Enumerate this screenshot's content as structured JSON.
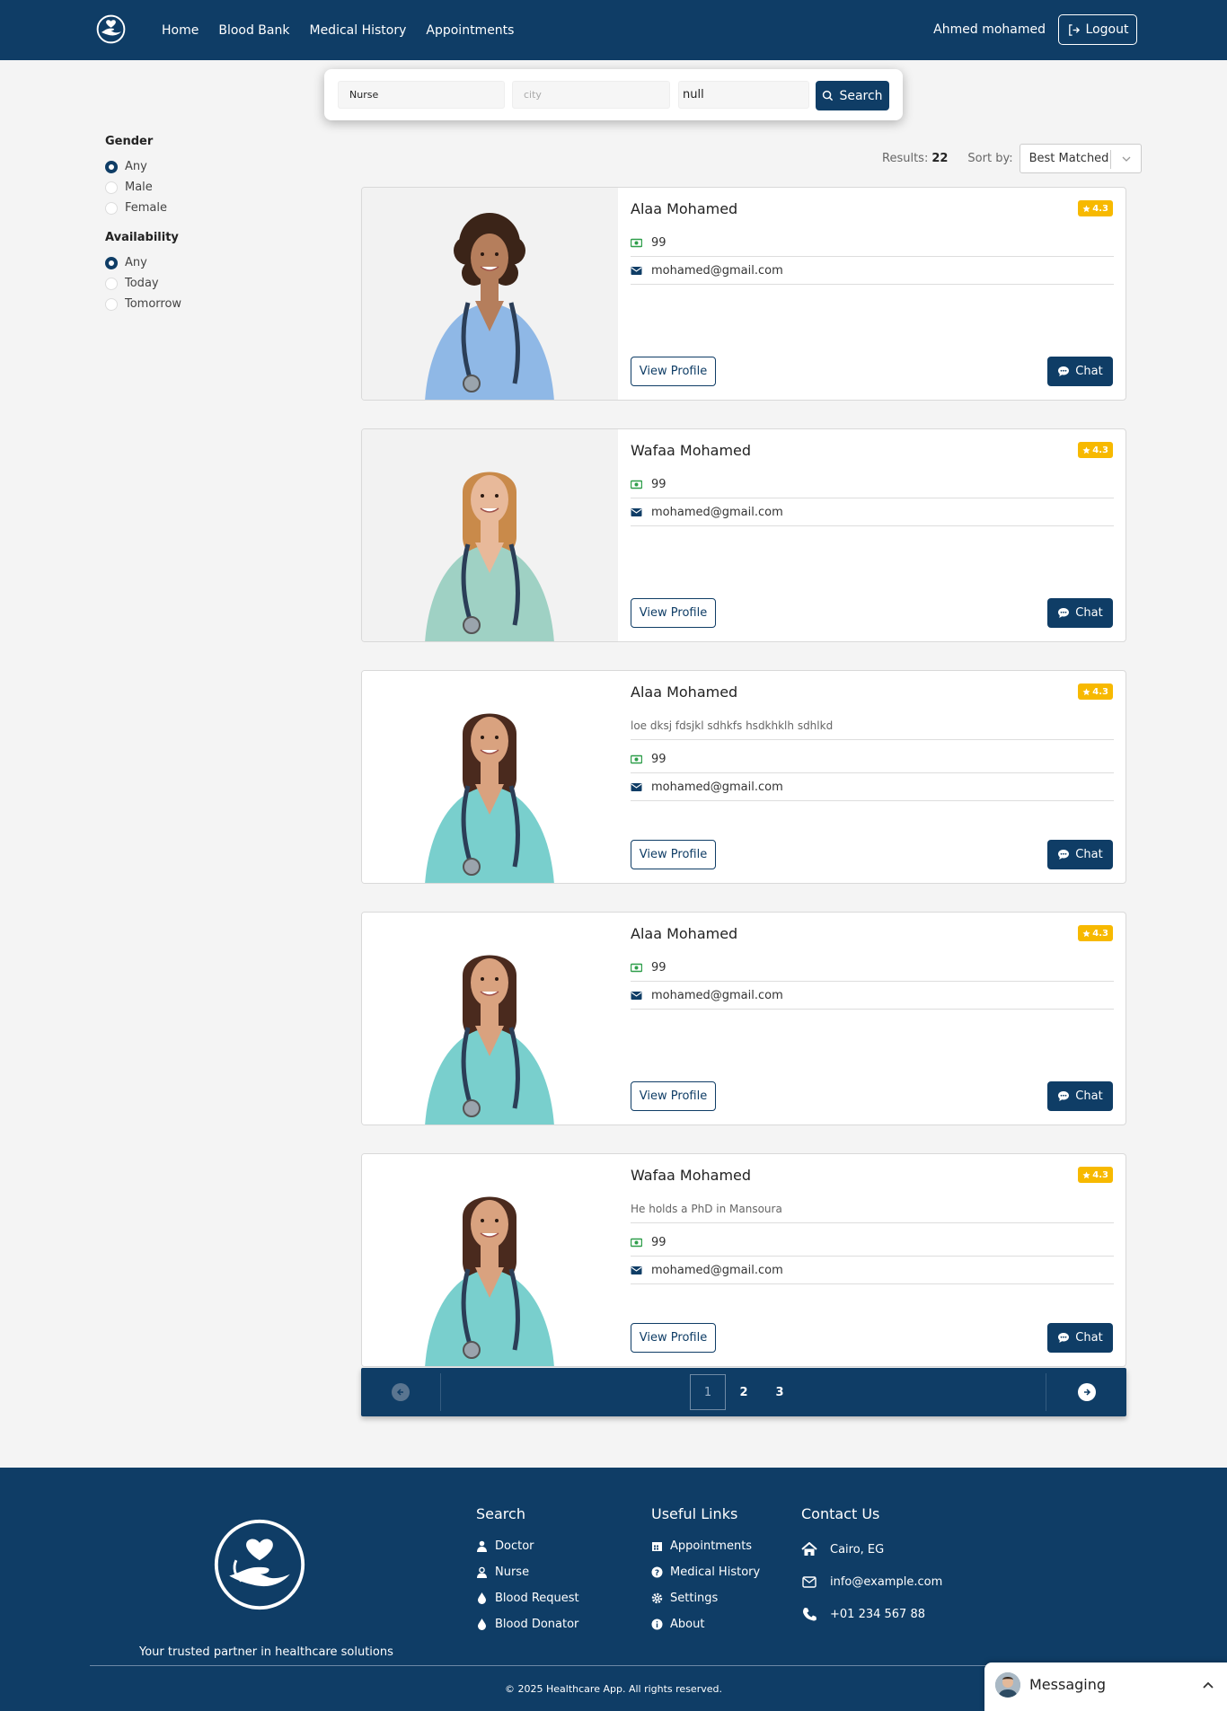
{
  "nav": {
    "links": [
      "Home",
      "Blood Bank",
      "Medical History",
      "Appointments"
    ],
    "user_name": "Ahmed mohamed",
    "logout_label": "Logout"
  },
  "search": {
    "specialty_value": "Nurse",
    "city_placeholder": "city",
    "third_value": "null",
    "button_label": "Search"
  },
  "filters": {
    "gender": {
      "title": "Gender",
      "options": [
        "Any",
        "Male",
        "Female"
      ],
      "selected": "Any"
    },
    "availability": {
      "title": "Availability",
      "options": [
        "Any",
        "Today",
        "Tomorrow"
      ],
      "selected": "Any"
    }
  },
  "results": {
    "label": "Results:",
    "count": "22",
    "sort_label": "Sort by:",
    "sort_value": "Best Matched"
  },
  "cards": [
    {
      "name": "Alaa Mohamed",
      "rating": "4.3",
      "description": "",
      "price": "99",
      "email": "mohamed@gmail.com",
      "view_label": "View Profile",
      "chat_label": "Chat"
    },
    {
      "name": "Wafaa Mohamed",
      "rating": "4.3",
      "description": "",
      "price": "99",
      "email": "mohamed@gmail.com",
      "view_label": "View Profile",
      "chat_label": "Chat"
    },
    {
      "name": "Alaa Mohamed",
      "rating": "4.3",
      "description": "loe dksj fdsjkl sdhkfs hsdkhklh sdhlkd",
      "price": "99",
      "email": "mohamed@gmail.com",
      "view_label": "View Profile",
      "chat_label": "Chat"
    },
    {
      "name": "Alaa Mohamed",
      "rating": "4.3",
      "description": "",
      "price": "99",
      "email": "mohamed@gmail.com",
      "view_label": "View Profile",
      "chat_label": "Chat"
    },
    {
      "name": "Wafaa Mohamed",
      "rating": "4.3",
      "description": "He holds a PhD in Mansoura",
      "price": "99",
      "email": "mohamed@gmail.com",
      "view_label": "View Profile",
      "chat_label": "Chat"
    }
  ],
  "pagination": {
    "pages": [
      "1",
      "2",
      "3"
    ],
    "current": "1"
  },
  "footer": {
    "tagline": "Your trusted partner in healthcare solutions",
    "search": {
      "title": "Search",
      "items": [
        "Doctor",
        "Nurse",
        "Blood Request",
        "Blood Donator"
      ]
    },
    "links": {
      "title": "Useful Links",
      "items": [
        "Appointments",
        "Medical History",
        "Settings",
        "About"
      ]
    },
    "contact": {
      "title": "Contact Us",
      "items": [
        "Cairo, EG",
        "info@example.com",
        "+01 234 567 88"
      ]
    },
    "copyright": "© 2025 Healthcare App. All rights reserved."
  },
  "messaging": {
    "label": "Messaging"
  },
  "colors": {
    "primary": "#0f3d66",
    "rating": "#f7b900",
    "price_icon": "#2e9e4a"
  }
}
